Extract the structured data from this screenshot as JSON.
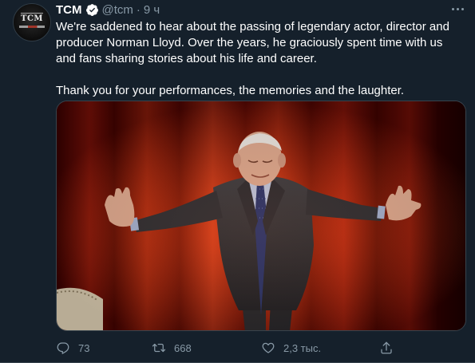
{
  "author": {
    "name": "TCM",
    "handle": "@tcm",
    "separator": "·",
    "time": "9 ч",
    "avatar_text": "TCM",
    "verified_color": "#ffffff"
  },
  "tweet": {
    "paragraph1": "We're saddened to hear about the passing of legendary actor, director and producer Norman Lloyd. Over the years, he graciously spent time with us and fans sharing stories about his life and career.",
    "paragraph2": "Thank you for your performances, the memories and the laughter."
  },
  "actions": {
    "replies": "73",
    "retweets": "668",
    "likes": "2,3 тыс."
  },
  "colors": {
    "background": "#15202b",
    "secondary_text": "#8899a6",
    "border": "#38444d",
    "curtain_red": "#b3150c"
  },
  "icons": {
    "more": "more-icon",
    "reply": "reply-icon",
    "retweet": "retweet-icon",
    "like": "heart-icon",
    "share": "share-icon",
    "verified": "verified-badge-icon"
  }
}
